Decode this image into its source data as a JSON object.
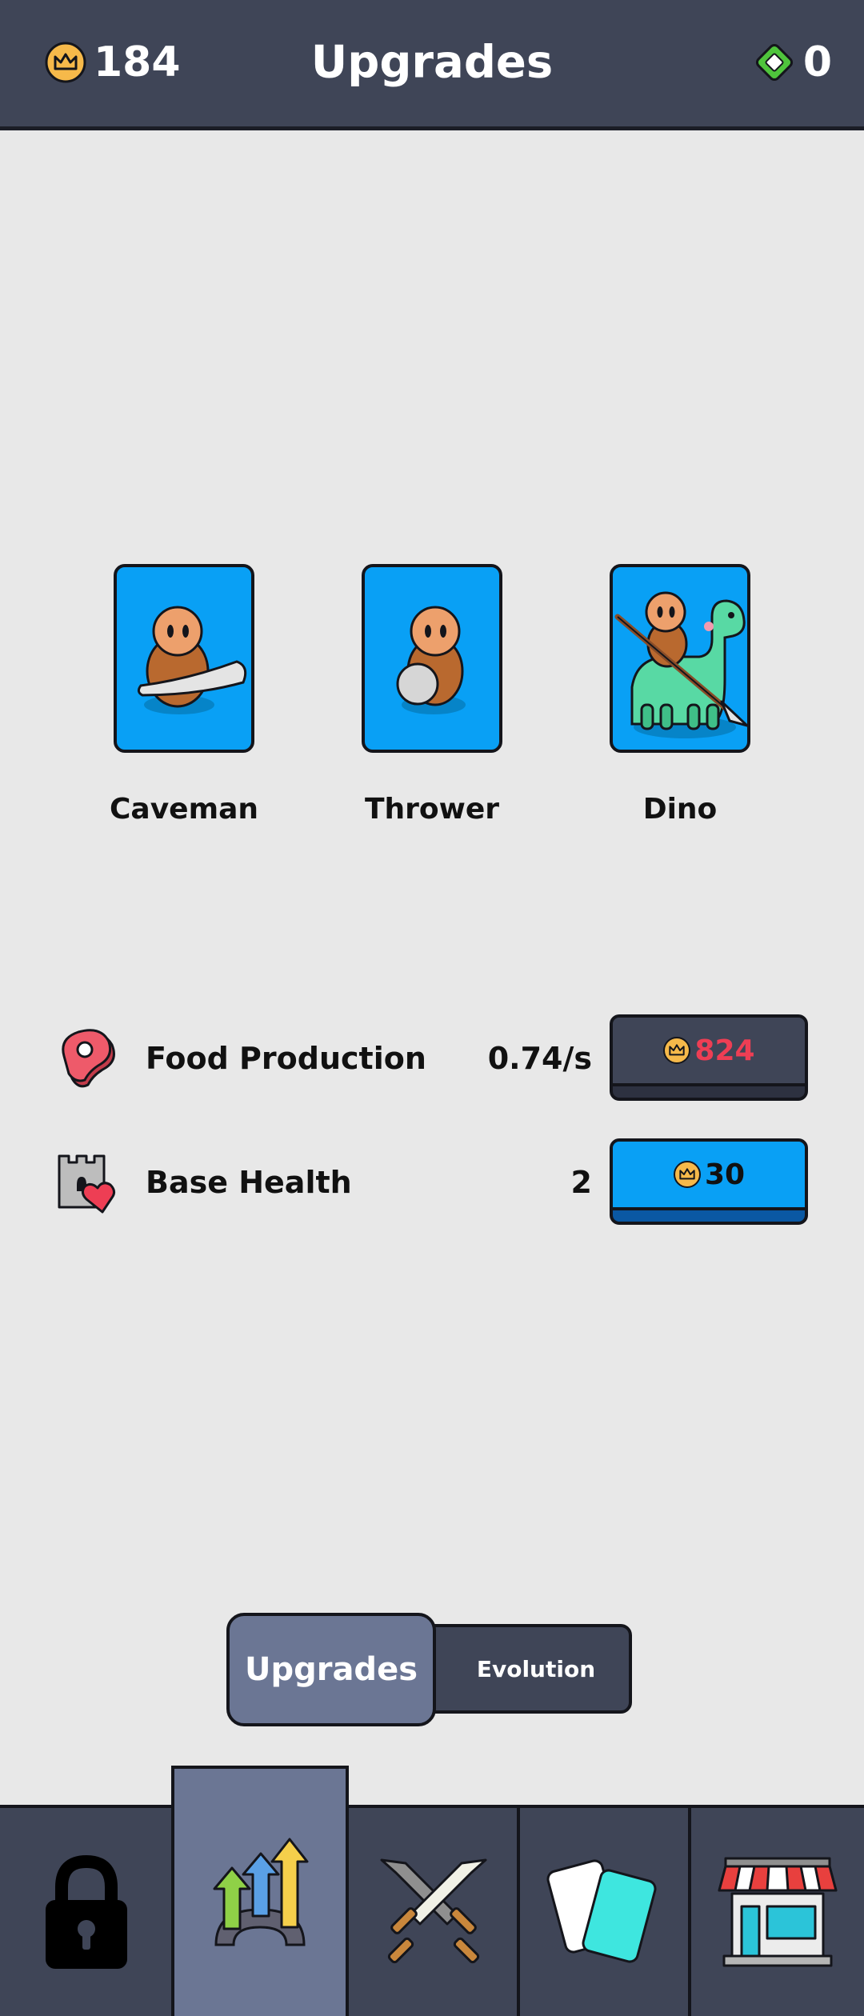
{
  "header": {
    "title": "Upgrades",
    "coins": "184",
    "gems": "0",
    "coin_icon": "crown-coin-icon",
    "gem_icon": "green-diamond-icon"
  },
  "units": [
    {
      "label": "Caveman",
      "icon": "caveman-club-icon"
    },
    {
      "label": "Thrower",
      "icon": "caveman-rock-icon"
    },
    {
      "label": "Dino",
      "icon": "dino-rider-spear-icon"
    }
  ],
  "upgrades": [
    {
      "name": "Food Production",
      "value": "0.74/s",
      "cost": "824",
      "icon": "meat-icon",
      "affordable": false
    },
    {
      "name": "Base Health",
      "value": "2",
      "cost": "30",
      "icon": "castle-heart-icon",
      "affordable": true
    }
  ],
  "toggle": {
    "upgrades": "Upgrades",
    "evolution": "Evolution",
    "selected": "Upgrades"
  },
  "nav": [
    {
      "icon": "lock-icon"
    },
    {
      "icon": "upgrade-arrows-gear-icon",
      "active": true
    },
    {
      "icon": "crossed-swords-icon"
    },
    {
      "icon": "cards-icon"
    },
    {
      "icon": "shop-icon"
    }
  ],
  "colors": {
    "header": "#3f4557",
    "card": "#09a0f5",
    "active_tab": "#6b7694",
    "cost_unaffordable": "#ee3e54",
    "background": "#e8e8e8"
  }
}
